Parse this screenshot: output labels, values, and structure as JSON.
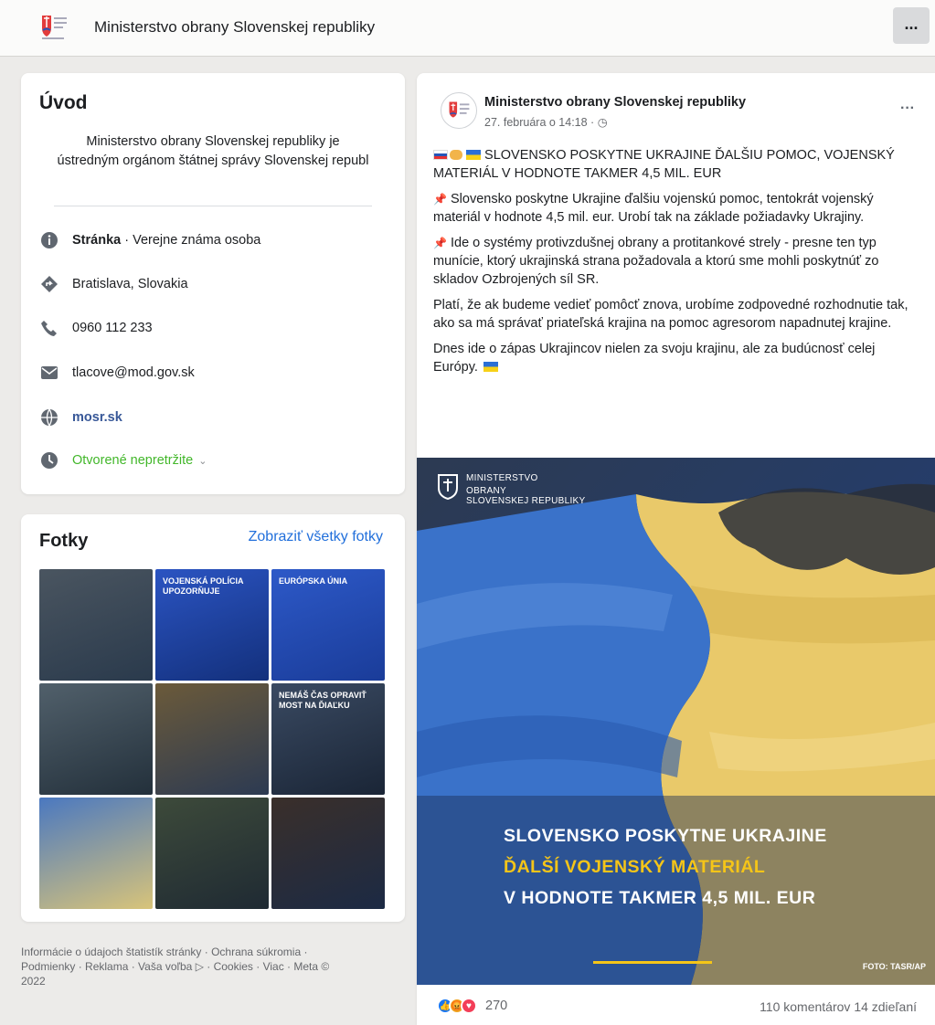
{
  "header": {
    "page_name": "Ministerstvo obrany Slovenskej republiky",
    "more_label": "..."
  },
  "intro": {
    "title": "Úvod",
    "description": "Ministerstvo obrany Slovenskej republiky je ústredným orgánom štátnej správy Slovenskej republ",
    "page_type_bold": "Stránka",
    "page_type_rest": " · Verejne známa osoba",
    "location": "Bratislava, Slovakia",
    "phone": "0960 112 233",
    "email": "tlacove@mod.gov.sk",
    "website": "mosr.sk",
    "hours": "Otvorené nepretržite"
  },
  "photos": {
    "title": "Fotky",
    "see_all": "Zobraziť všetky fotky",
    "tiles": [
      {
        "text": "",
        "color1": "#4a5560",
        "color2": "#2a3a4c"
      },
      {
        "text": "VOJENSKÁ POLÍCIA UPOZORŇUJE",
        "color1": "#2b54c2",
        "color2": "#13307c"
      },
      {
        "text": "EURÓPSKA ÚNIA",
        "color1": "#2d59c8",
        "color2": "#1a3c99"
      },
      {
        "text": "",
        "color1": "#51606b",
        "color2": "#23303b"
      },
      {
        "text": "",
        "color1": "#6b5a3a",
        "color2": "#2c3a52"
      },
      {
        "text": "NEMÁŠ ČAS OPRAVIŤ MOST NA ĎIAĽKU",
        "color1": "#3a4a62",
        "color2": "#1a2536"
      },
      {
        "text": "",
        "color1": "#4a78c0",
        "color2": "#d8c47a"
      },
      {
        "text": "",
        "color1": "#3d4a3a",
        "color2": "#1f2a33"
      },
      {
        "text": "",
        "color1": "#3a2f2a",
        "color2": "#1c2a44"
      }
    ]
  },
  "footer": {
    "line1": "Informácie o údajoch štatistík stránky · Ochrana súkromia ·",
    "line2": "Podmienky · Reklama · Vaša voľba ▷ · Cookies · Viac · Meta ©",
    "line3": "2022"
  },
  "post": {
    "author": "Ministerstvo obrany Slovenskej republiky",
    "date": "27. februára o 14:18 · ◷",
    "more_label": "···",
    "headline": "SLOVENSKO POSKYTNE UKRAJINE ĎALŠIU POMOC, VOJENSKÝ MATERIÁL V HODNOTE TAKMER 4,5 MIL. EUR",
    "p1": "Slovensko poskytne Ukrajine ďalšiu vojenskú pomoc, tentokrát vojenský materiál v hodnote 4,5 mil. eur. Urobí tak na základe požiadavky Ukrajiny.",
    "p2": "Ide o systémy protivzdušnej obrany a protitankové strely - presne ten typ munície, ktorý ukrajinská strana požadovala a ktorú sme mohli poskytnúť zo skladov Ozbrojených síl SR.",
    "p3": "Platí, že ak budeme vedieť pomôcť znova, urobíme zodpovedné rozhodnutie tak, ako sa má správať priateľská krajina na pomoc agresorom napadnutej krajine.",
    "p4": "Dnes ide o zápas Ukrajincov nielen za svoju krajinu, ale za budúcnosť celej Európy.",
    "image": {
      "logo_line1": "MINISTERSTVO",
      "logo_line2": "OBRANY",
      "logo_line3": "SLOVENSKEJ REPUBLIKY",
      "headline1": "SLOVENSKO POSKYTNE UKRAJINE",
      "headline2": "ĎALŠÍ VOJENSKÝ MATERIÁL",
      "headline3": "V HODNOTE TAKMER 4,5 MIL. EUR",
      "credit": "FOTO: TASR/AP"
    },
    "reaction_count": "270",
    "comments": "110 komentárov",
    "shares": "14 zdieľaní"
  },
  "colors": {
    "link_blue": "#216fdb",
    "green": "#42b72a",
    "accent_yellow": "#f5c518",
    "ukraine_blue": "#2b6fd6"
  }
}
